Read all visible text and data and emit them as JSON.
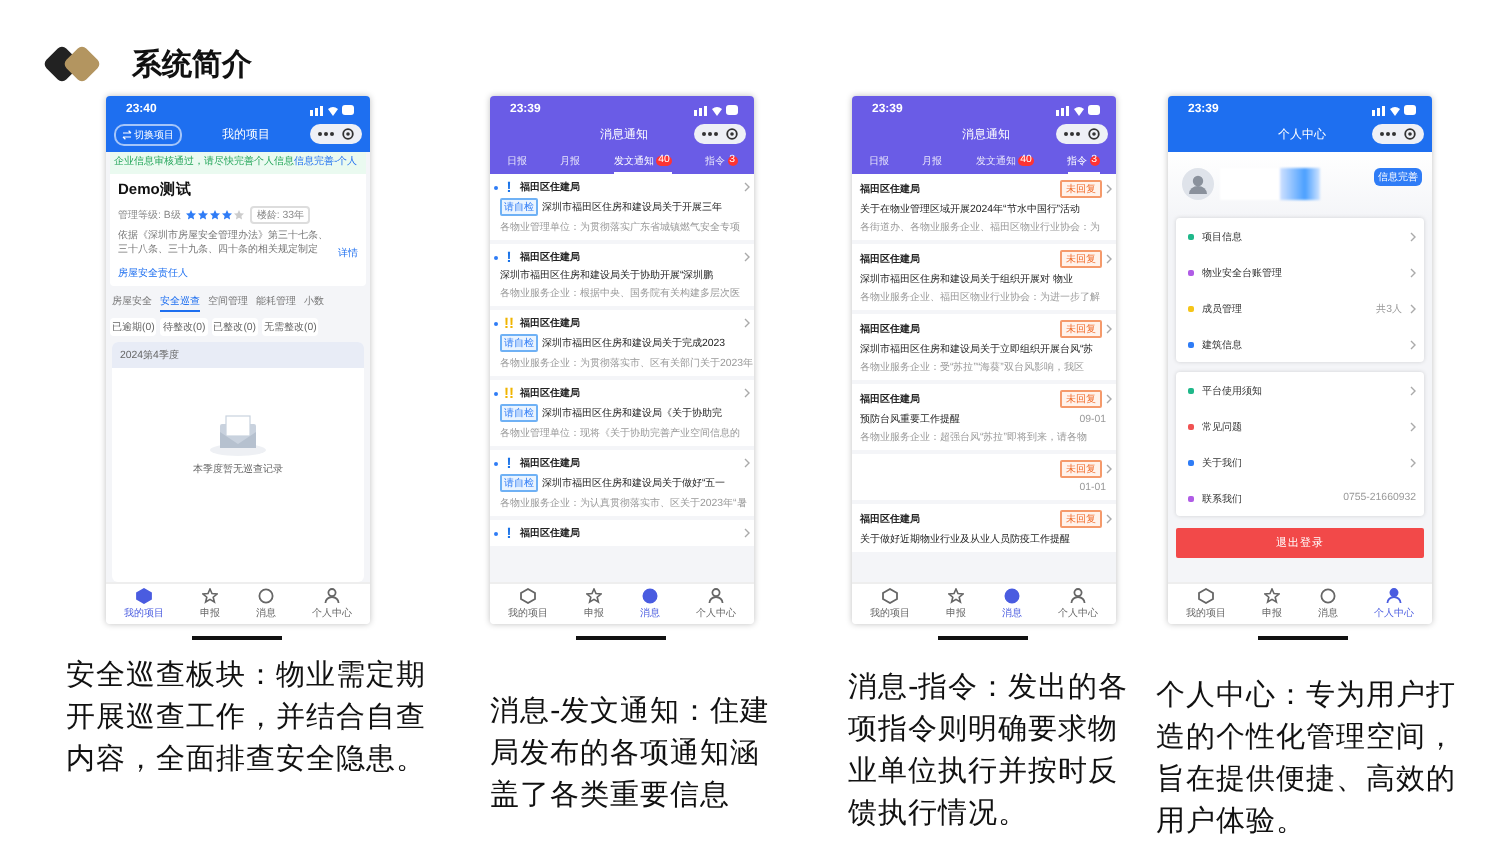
{
  "title": "系统简介",
  "phones": [
    {
      "kind": "project",
      "time": "23:40",
      "nav_title": "我的项目",
      "switch_button": "切换项目",
      "notice": {
        "text": "企业信息审核通过，请尽快完善个人信息",
        "link": "信息完善-个人"
      },
      "project": {
        "name": "Demo测试",
        "level_label": "管理等级: B级",
        "stars": 4,
        "age": "楼龄: 33年",
        "description": "依据《深圳市房屋安全管理办法》第三十七条、三十八条、三十九条、四十条的相关规定制定",
        "detail_link": "详情",
        "owner": "房屋安全责任人"
      },
      "tabs": [
        {
          "label": "房屋安全",
          "selected": false
        },
        {
          "label": "安全巡查",
          "selected": true
        },
        {
          "label": "空间管理",
          "selected": false
        },
        {
          "label": "能耗管理",
          "selected": false
        },
        {
          "label": "小数",
          "selected": false
        }
      ],
      "filters": [
        "已逾期(0)",
        "待整改(0)",
        "已整改(0)",
        "无需整改(0)"
      ],
      "quarter": "2024第4季度",
      "empty_text": "本季度暂无巡查记录",
      "tabbar": [
        {
          "label": "我的项目",
          "selected": true
        },
        {
          "label": "申报",
          "selected": false
        },
        {
          "label": "消息",
          "selected": false
        },
        {
          "label": "个人中心",
          "selected": false
        }
      ]
    },
    {
      "kind": "notices",
      "time": "23:39",
      "nav_title": "消息通知",
      "tabs": [
        {
          "label": "日报",
          "selected": false
        },
        {
          "label": "月报",
          "selected": false
        },
        {
          "label": "发文通知",
          "selected": true,
          "badge": "40"
        },
        {
          "label": "指令",
          "selected": false,
          "badge": "3"
        }
      ],
      "items": [
        {
          "unread": true,
          "priority": "!",
          "color": "#1a73e8",
          "sender": "福田区住建局",
          "tag": "请自检",
          "title": "深圳市福田区住房和建设局关于开展三年",
          "excerpt": "各物业管理单位：为贯彻落实广东省城镇燃气安全专项"
        },
        {
          "unread": true,
          "priority": "!",
          "color": "#1a73e8",
          "sender": "福田区住建局",
          "title": "深圳市福田区住房和建设局关于协助开展“深圳鹏",
          "excerpt": "各物业服务企业：根据中央、国务院有关构建多层次医"
        },
        {
          "unread": true,
          "priority": "!!",
          "color": "#f0b400",
          "sender": "福田区住建局",
          "tag": "请自检",
          "title": "深圳市福田区住房和建设局关于完成2023",
          "excerpt": "各物业服务企业：为贯彻落实市、区有关部门关于2023年"
        },
        {
          "unread": true,
          "priority": "!!",
          "color": "#f0b400",
          "sender": "福田区住建局",
          "tag": "请自检",
          "title": "深圳市福田区住房和建设局《关于协助完",
          "excerpt": "各物业管理单位：现将《关于协助完善产业空间信息的"
        },
        {
          "unread": true,
          "priority": "!",
          "color": "#1a73e8",
          "sender": "福田区住建局",
          "tag": "请自检",
          "title": "深圳市福田区住房和建设局关于做好“五一",
          "excerpt": "各物业服务企业：为认真贯彻落实市、区关于2023年“暑"
        },
        {
          "unread": true,
          "priority": "!",
          "color": "#1a73e8",
          "sender": "福田区住建局"
        }
      ],
      "tabbar": [
        {
          "label": "我的项目",
          "selected": false
        },
        {
          "label": "申报",
          "selected": false
        },
        {
          "label": "消息",
          "selected": true
        },
        {
          "label": "个人中心",
          "selected": false
        }
      ]
    },
    {
      "kind": "commands",
      "time": "23:39",
      "nav_title": "消息通知",
      "tabs": [
        {
          "label": "日报",
          "selected": false
        },
        {
          "label": "月报",
          "selected": false
        },
        {
          "label": "发文通知",
          "selected": false,
          "badge": "40"
        },
        {
          "label": "指令",
          "selected": true,
          "badge": "3"
        }
      ],
      "items": [
        {
          "sender": "福田区住建局",
          "status": "未回复",
          "title": "关于在物业管理区域开展2024年“节水中国行”活动",
          "excerpt": "各街道办、各物业服务企业、福田区物业行业协会：为"
        },
        {
          "sender": "福田区住建局",
          "status": "未回复",
          "title": "深圳市福田区住房和建设局关于组织开展对 物业",
          "excerpt": "各物业服务企业、福田区物业行业协会：为进一步了解"
        },
        {
          "sender": "福田区住建局",
          "status": "未回复",
          "title": "深圳市福田区住房和建设局关于立即组织开展台风“苏",
          "excerpt": "各物业服务企业：受“苏拉”“海葵”双台风影响，我区"
        },
        {
          "sender": "福田区住建局",
          "status": "未回复",
          "title": "预防台风重要工作提醒",
          "date": "09-01",
          "excerpt": "各物业服务企业：超强台风“苏拉”即将到来，请各物"
        },
        {
          "status": "未回复",
          "date": "01-01"
        },
        {
          "sender": "福田区住建局",
          "status": "未回复",
          "title": "关于做好近期物业行业及从业人员防疫工作提醒"
        }
      ],
      "tabbar": [
        {
          "label": "我的项目",
          "selected": false
        },
        {
          "label": "申报",
          "selected": false
        },
        {
          "label": "消息",
          "selected": true
        },
        {
          "label": "个人中心",
          "selected": false
        }
      ]
    },
    {
      "kind": "profile",
      "time": "23:39",
      "nav_title": "个人中心",
      "info_badge": "信息完善",
      "groups": [
        [
          {
            "label": "项目信息",
            "color": "#1fb88a"
          },
          {
            "label": "物业安全台账管理",
            "color": "#b05ce6"
          },
          {
            "label": "成员管理",
            "color": "#f5c518",
            "value": "共3人"
          },
          {
            "label": "建筑信息",
            "color": "#2f7cf6"
          }
        ],
        [
          {
            "label": "平台使用须知",
            "color": "#1fb88a"
          },
          {
            "label": "常见问题",
            "color": "#f05252"
          },
          {
            "label": "关于我们",
            "color": "#2f7cf6"
          },
          {
            "label": "联系我们",
            "color": "#b05ce6",
            "value": "0755-21660932",
            "arrow": false
          }
        ]
      ],
      "logout": "退出登录",
      "tabbar": [
        {
          "label": "我的项目",
          "selected": false
        },
        {
          "label": "申报",
          "selected": false
        },
        {
          "label": "消息",
          "selected": false
        },
        {
          "label": "个人中心",
          "selected": true
        }
      ]
    }
  ],
  "captions": [
    "安全巡查板块：物业需定期开展巡查工作，并结合自查内容，全面排查安全隐患。",
    "消息-发文通知：住建局发布的各项通知涵盖了各类重要信息",
    "消息-指令：发出的各项指令则明确要求物业单位执行并按时反馈执行情况。",
    "个人中心：专为用户打造的个性化管理空间，旨在提供便捷、高效的用户体验。"
  ]
}
